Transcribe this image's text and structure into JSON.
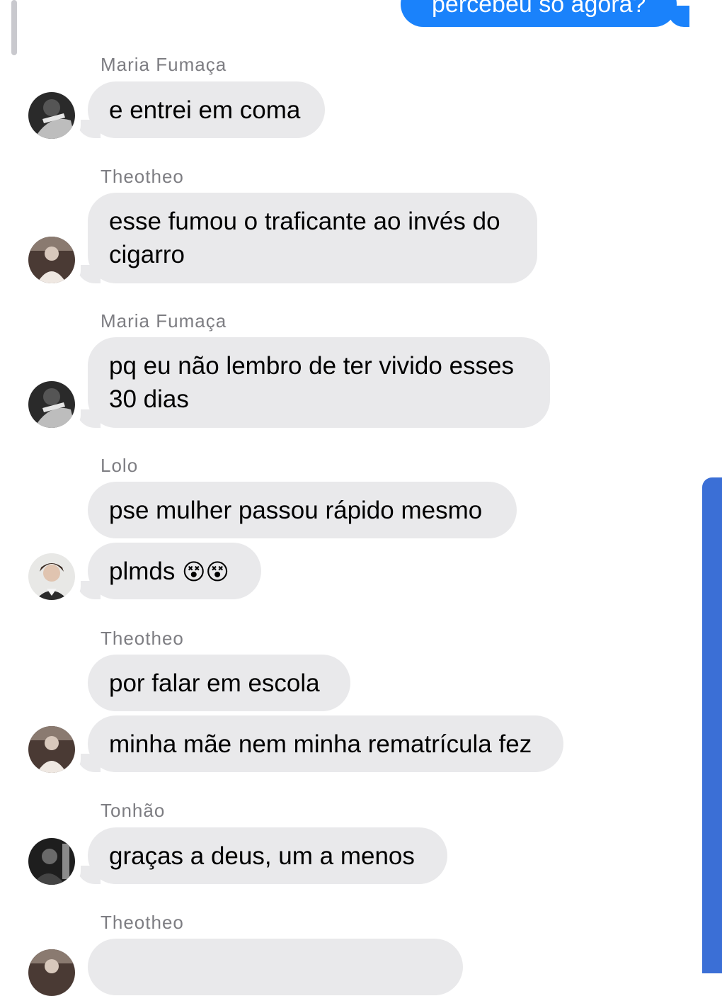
{
  "outgoing": {
    "text": "percebeu só agora?"
  },
  "colors": {
    "outgoing_bubble": "#1a82fb",
    "incoming_bubble": "#e9e9eb",
    "sender_name": "#7d7d82",
    "scrollbar": "#3b6fd6"
  },
  "messages": [
    {
      "sender": "Maria Fumaça",
      "avatar": "avatar-maria",
      "texts": [
        "e entrei em coma"
      ]
    },
    {
      "sender": "Theotheo",
      "avatar": "avatar-theotheo",
      "texts": [
        "esse fumou o traficante ao invés do cigarro"
      ]
    },
    {
      "sender": "Maria Fumaça",
      "avatar": "avatar-maria",
      "texts": [
        "pq eu não lembro de ter vivido esses 30 dias"
      ]
    },
    {
      "sender": "Lolo",
      "avatar": "avatar-lolo",
      "texts": [
        "pse mulher passou rápido mesmo",
        "plmds",
        "😵😵"
      ]
    },
    {
      "sender": "Theotheo",
      "avatar": "avatar-theotheo",
      "texts": [
        "por falar em escola",
        "minha mãe nem minha rematrícula fez"
      ]
    },
    {
      "sender": "Tonhão",
      "avatar": "avatar-tonhao",
      "texts": [
        "graças a deus, um a menos"
      ]
    },
    {
      "sender": "Theotheo",
      "avatar": "avatar-theotheo",
      "texts": []
    }
  ]
}
